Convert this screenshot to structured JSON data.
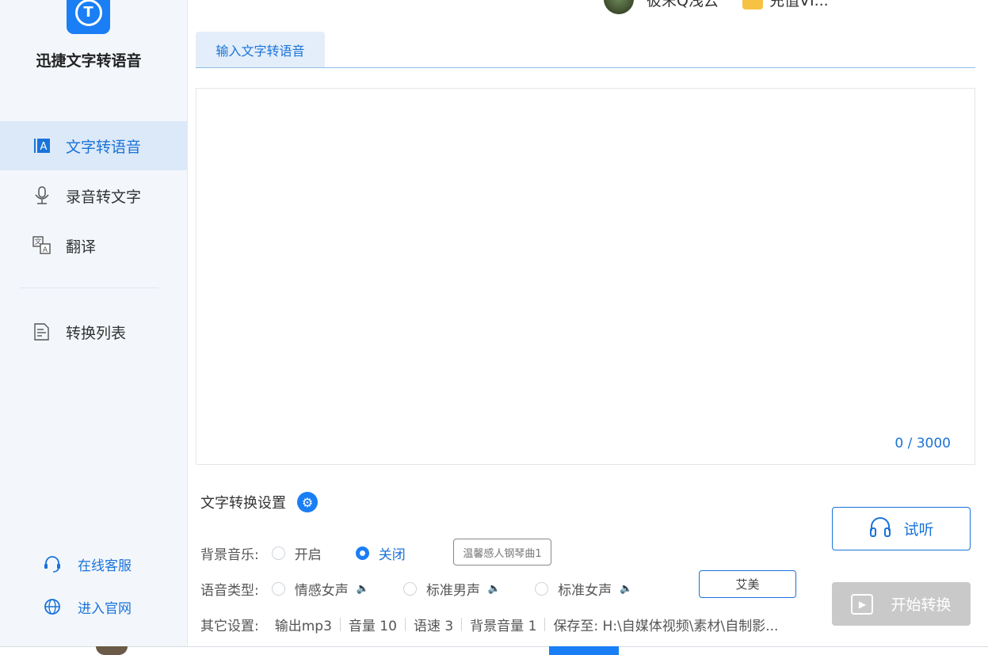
{
  "app": {
    "name": "迅捷文字转语音",
    "logo_letter": "T"
  },
  "topbar": {
    "username": "彼末Q浅云",
    "vip_text": "充值VI..."
  },
  "sidebar": {
    "items": [
      {
        "label": "文字转语音",
        "icon": "text-to-speech-icon",
        "active": true
      },
      {
        "label": "录音转文字",
        "icon": "microphone-icon",
        "active": false
      },
      {
        "label": "翻译",
        "icon": "translate-icon",
        "active": false
      },
      {
        "label": "转换列表",
        "icon": "list-icon",
        "active": false
      }
    ],
    "footer": [
      {
        "label": "在线客服",
        "icon": "customer-service-icon"
      },
      {
        "label": "进入官网",
        "icon": "globe-icon"
      }
    ]
  },
  "tabs": [
    {
      "label": "输入文字转语音",
      "active": true
    }
  ],
  "editor": {
    "value": "",
    "count": "0 / 3000"
  },
  "settings": {
    "title": "文字转换设置",
    "bg_music": {
      "label": "背景音乐:",
      "options": [
        {
          "label": "开启",
          "checked": false
        },
        {
          "label": "关闭",
          "checked": true
        }
      ],
      "selected_track": "温馨感人钢琴曲1"
    },
    "voice_type": {
      "label": "语音类型:",
      "options": [
        {
          "label": "情感女声",
          "checked": false
        },
        {
          "label": "标准男声",
          "checked": false
        },
        {
          "label": "标准女声",
          "checked": false
        }
      ],
      "selected_voice": "艾美"
    },
    "other": {
      "label": "其它设置:",
      "items": [
        "输出mp3",
        "音量 10",
        "语速 3",
        "背景音量 1",
        "保存至: H:\\自媒体视频\\素材\\自制影..."
      ]
    }
  },
  "buttons": {
    "listen": "试听",
    "convert": "开始转换"
  },
  "colors": {
    "accent": "#1a7ef5",
    "sidebar_bg": "#f3f7fc",
    "disabled": "#c9c9c9"
  }
}
